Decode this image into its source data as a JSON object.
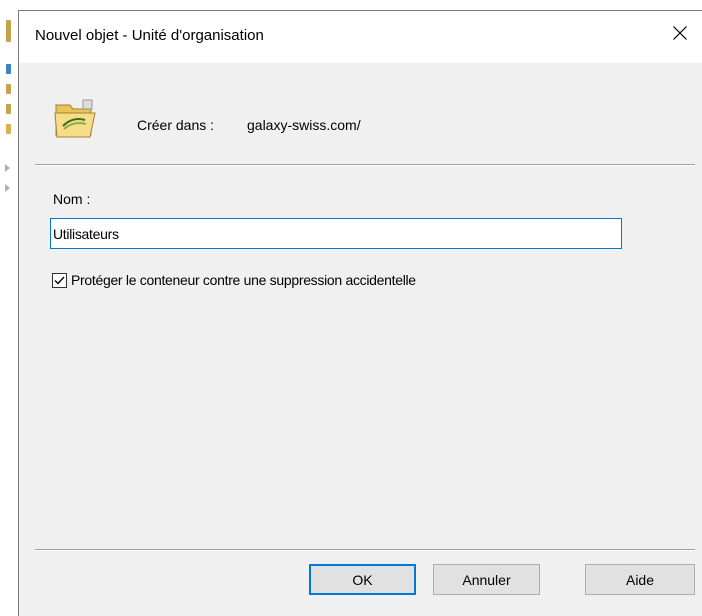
{
  "dialog": {
    "title": "Nouvel objet - Unité d'organisation",
    "close_icon": "close-icon"
  },
  "header": {
    "icon": "folder-ou-icon",
    "create_label": "Créer dans :",
    "create_path": "galaxy-swiss.com/"
  },
  "form": {
    "name_label": "Nom :",
    "name_value": "Utilisateurs",
    "protect_checkbox": {
      "label": "Protéger le conteneur contre une suppression accidentelle",
      "checked": true
    }
  },
  "buttons": {
    "ok_label": "OK",
    "cancel_label": "Annuler",
    "help_label": "Aide"
  },
  "colors": {
    "accent": "#0078d7",
    "dialog_bg": "#f0f0f0",
    "titlebar_bg": "#ffffff"
  }
}
